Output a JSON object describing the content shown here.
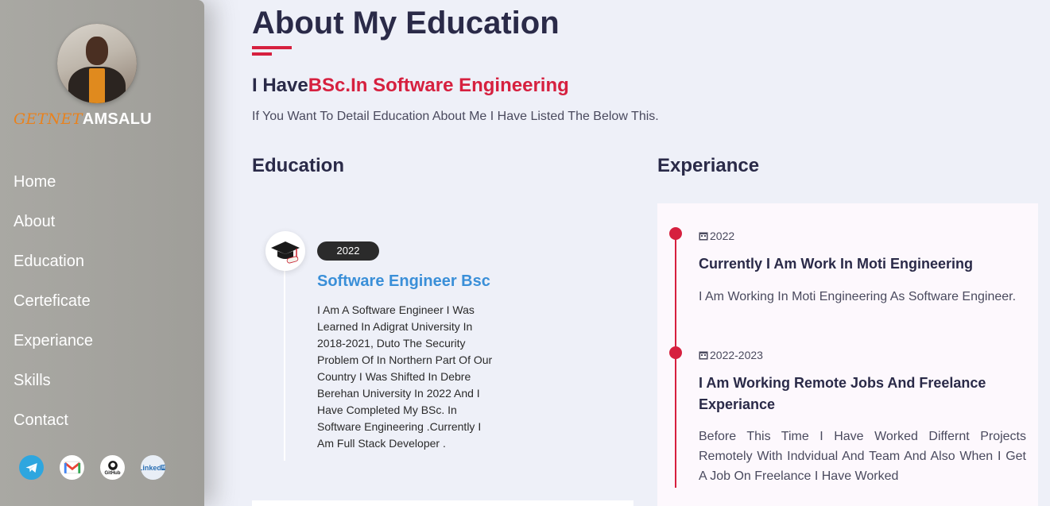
{
  "sidebar": {
    "brand_first": "GETNET",
    "brand_last": "AMSALU",
    "nav": [
      "Home",
      "About",
      "Education",
      "Certeficate",
      "Experiance",
      "Skills",
      "Contact"
    ],
    "socials": [
      {
        "name": "telegram-icon",
        "color": "#2ea6df"
      },
      {
        "name": "gmail-icon",
        "color": "#ea4335"
      },
      {
        "name": "github-icon",
        "color": "#1b1b1b",
        "label": "GitHub"
      },
      {
        "name": "linkedin-icon",
        "color": "#2a6fb3",
        "label": "Linked"
      }
    ]
  },
  "main": {
    "title": "About My Education",
    "subhead_prefix": "I Have",
    "subhead_accent": "BSc.In Software Engineering",
    "intro": "If You Want To Detail Education About Me I Have Listed The Below This.",
    "education": {
      "heading": "Education",
      "items": [
        {
          "year": "2022",
          "title": "Software Engineer Bsc",
          "desc": "I Am A Software Engineer I Was Learned In Adigrat University In 2018-2021, Duto The Security Problem Of In Northern Part Of Our Country I Was Shifted In Debre Berehan University In 2022 And I Have Completed My BSc. In Software Engineering .Currently I Am Full Stack Developer ."
        }
      ]
    },
    "experience": {
      "heading": "Experiance",
      "items": [
        {
          "date": "2022",
          "title": "Currently I Am Work In Moti Engineering",
          "desc": "I Am Working In Moti Engineering As Software Engineer."
        },
        {
          "date": "2022-2023",
          "title": "I Am Working Remote Jobs And Freelance Experiance",
          "desc": "Before This Time I Have Worked Differnt Projects Remotely With Indvidual And Team And Also When I Get A Job On Freelance I Have Worked"
        }
      ]
    }
  },
  "colors": {
    "accent": "#d6203f",
    "heading": "#2a2a48",
    "link_blue": "#3a8fd8",
    "brand_orange": "#e8821e"
  }
}
